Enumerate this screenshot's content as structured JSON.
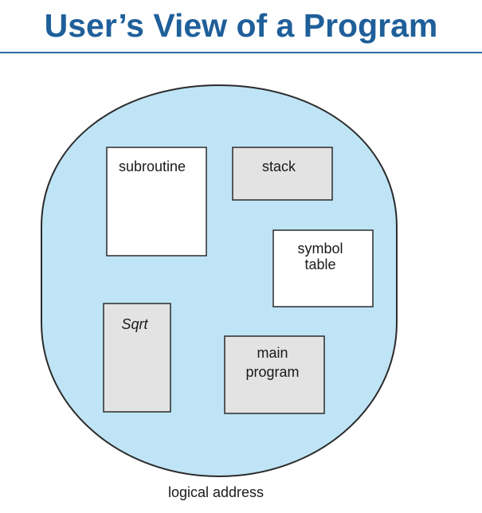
{
  "title": "User’s View of a Program",
  "colors": {
    "title": "#1f5f9a",
    "rule": "#2a6aa8",
    "address_space_fill": "#bfe4f5",
    "segment_white": "#ffffff",
    "segment_gray": "#e3e3e3",
    "outline": "#2b2b2b"
  },
  "segments": {
    "subroutine": "subroutine",
    "stack": "stack",
    "symbol_table_line1": "symbol",
    "symbol_table_line2": "table",
    "sqrt": "Sqrt",
    "main_program_line1": "main",
    "main_program_line2": "program"
  },
  "caption": "logical address"
}
